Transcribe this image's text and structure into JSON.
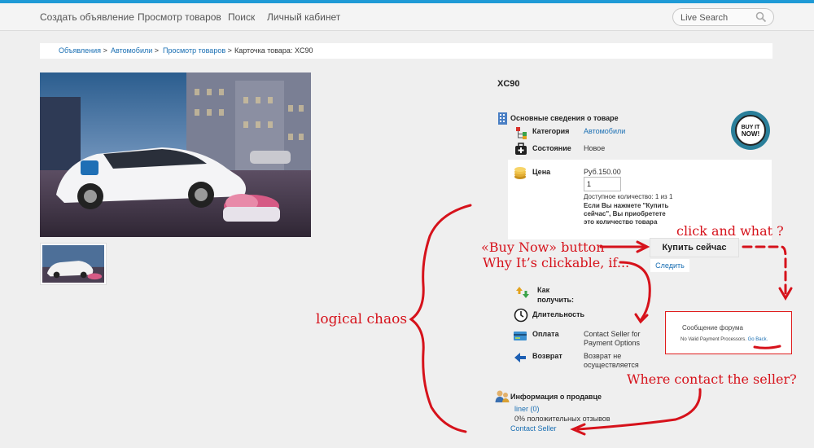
{
  "nav": {
    "items": [
      "Создать объявление",
      "Просмотр товаров",
      "Поиск",
      "Личный кабинет"
    ],
    "search_placeholder": "Live Search"
  },
  "breadcrumb": {
    "items": [
      "Объявления",
      "Автомобили",
      "Просмотр товаров"
    ],
    "separator": ">",
    "current": "Карточка товара: XC90"
  },
  "product": {
    "title": "XC90",
    "badge_text": [
      "BUY IT",
      "NOW!"
    ],
    "main_section_title": "Основные сведения о товаре",
    "category_label": "Категория",
    "category_value": "Автомобили",
    "condition_label": "Состояние",
    "condition_value": "Новое",
    "price_label": "Цена",
    "price_value": "Руб.150.00",
    "quantity_value": "1",
    "available_text": "Доступное количество: 1 из 1",
    "buy_note": "Если Вы нажмете \"Купить сейчас\", Вы приобретете это количество товара",
    "buy_button": "Купить сейчас",
    "follow_link": "Следить",
    "receive_title": "Как получить:",
    "duration_label": "Длительность",
    "payment_label": "Оплата",
    "payment_value": "Contact Seller for Payment Options",
    "return_label": "Возврат",
    "return_value": "Возврат не осуществляется"
  },
  "seller": {
    "section_title": "Информация о продавце",
    "name": "liner (0)",
    "feedback": "0% положительных отзывов",
    "contact_link": "Contact Seller"
  },
  "forum_popup": {
    "title": "Сообщение форума",
    "message": "No Valid Payment Processors.",
    "link": "Go Back."
  },
  "annotations": {
    "click_and_what": "click and what ?",
    "buy_now": "«Buy Now» button",
    "why_clickable": "Why It’s clickable, if...",
    "logical_chaos": "logical chaos",
    "where_contact": "Where contact the seller?"
  },
  "colors": {
    "accent": "#1e9ad6",
    "link": "#1a6fb3",
    "annotation": "#d6121b"
  }
}
